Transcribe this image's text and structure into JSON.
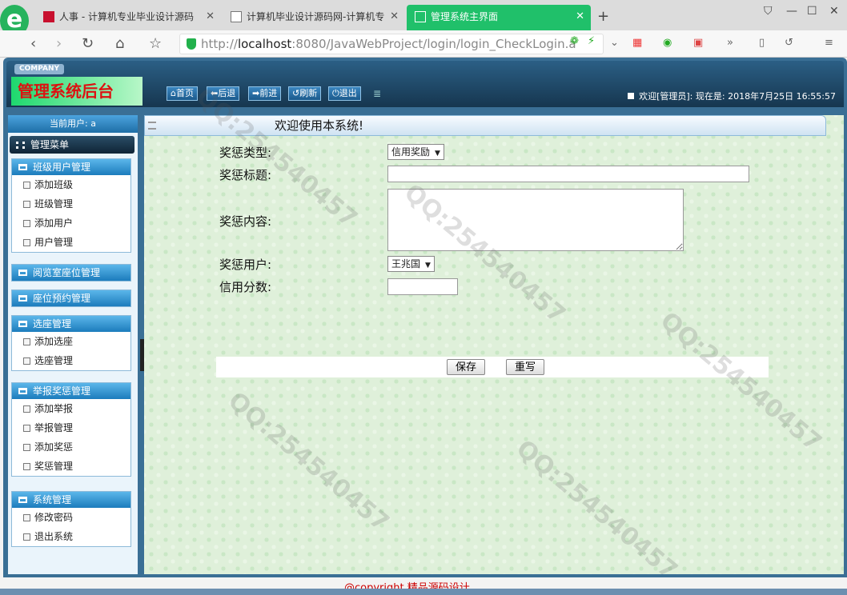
{
  "browser": {
    "tabs": [
      {
        "title": "人事 - 计算机专业毕业设计源码"
      },
      {
        "title": "计算机毕业设计源码网-计算机专"
      },
      {
        "title": "管理系统主界面"
      }
    ],
    "new_tab": "+",
    "url_prefix": "http://",
    "url_host": "localhost",
    "url_rest": ":8080/JavaWebProject/login/login_CheckLogin.a",
    "tab_close": "✕"
  },
  "app": {
    "company": "COMPANY",
    "title": "管理系统后台",
    "toolbar": {
      "home": "首页",
      "back": "后退",
      "forward": "前进",
      "refresh": "刷新",
      "exit": "退出"
    },
    "welcome": "欢迎[管理员]:",
    "now_label": "现在是:",
    "datetime": "2018年7月25日 16:55:57",
    "current_user": "当前用户: a",
    "menu_title": "管理菜单",
    "groups": [
      {
        "title": "班级用户管理",
        "items": [
          "添加班级",
          "班级管理",
          "添加用户",
          "用户管理"
        ]
      },
      {
        "title": "阅览室座位管理",
        "items": []
      },
      {
        "title": "座位预约管理",
        "items": []
      },
      {
        "title": "选座管理",
        "items": [
          "添加选座",
          "选座管理"
        ]
      },
      {
        "title": "举报奖惩管理",
        "items": [
          "添加举报",
          "举报管理",
          "添加奖惩",
          "奖惩管理"
        ]
      },
      {
        "title": "系统管理",
        "items": [
          "修改密码",
          "退出系统"
        ]
      }
    ]
  },
  "main": {
    "title": "欢迎使用本系统!",
    "form": {
      "type_label": "奖惩类型:",
      "type_value": "信用奖励",
      "title_label": "奖惩标题:",
      "title_value": "",
      "content_label": "奖惩内容:",
      "content_value": "",
      "user_label": "奖惩用户:",
      "user_value": "王兆国",
      "score_label": "信用分数:",
      "score_value": "",
      "save": "保存",
      "reset": "重写"
    }
  },
  "footer": "@copyright 精品源码设计"
}
